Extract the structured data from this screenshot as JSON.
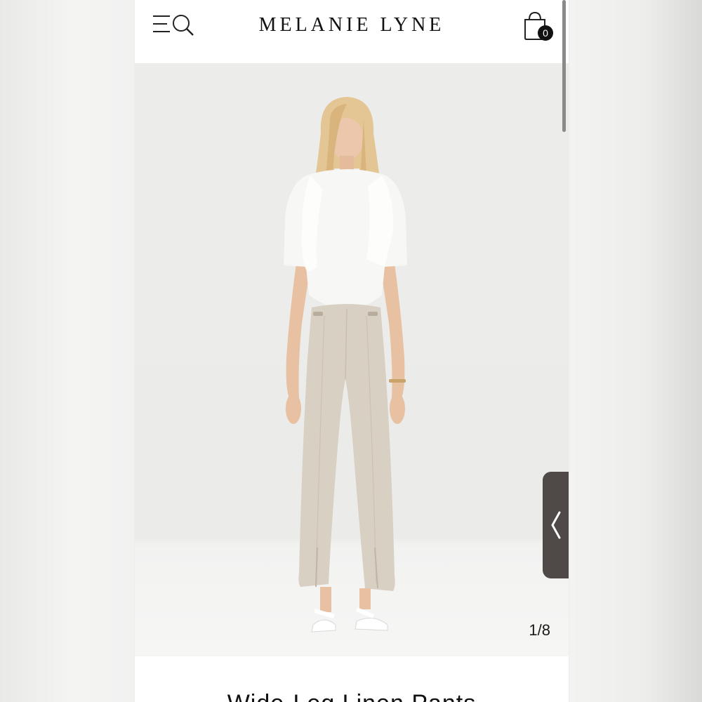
{
  "header": {
    "brand": "MELANIE LYNE",
    "menu_icon": "menu-search-icon",
    "cart_icon": "shopping-bag-icon",
    "cart_count": "0"
  },
  "gallery": {
    "counter": "1/8",
    "side_tab_icon": "chevron-left-icon"
  },
  "product": {
    "title": "Wide-Leg Linen Pants"
  },
  "colors": {
    "brand_text": "#111111",
    "side_tab": "#4f4a47",
    "pants": "#d8d0c3",
    "top": "#f7f7f6"
  }
}
